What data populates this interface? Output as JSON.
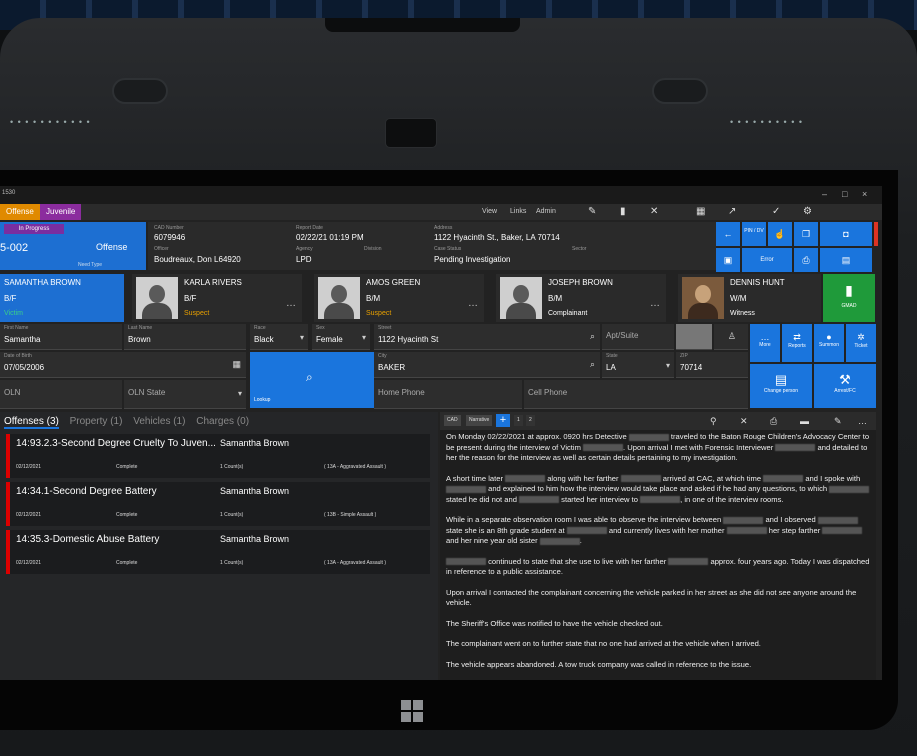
{
  "app": {
    "title": "1530"
  },
  "window_controls": {
    "minimize": "–",
    "maximize": "□",
    "close": "×"
  },
  "tabs": [
    {
      "label": "Offense"
    },
    {
      "label": "Juvenile"
    }
  ],
  "top_menu": {
    "view": "View",
    "links": "Links",
    "admin": "Admin"
  },
  "case": {
    "status": "In Progress",
    "number": "5-002",
    "type": "Offense",
    "sub": "Need Type",
    "cad_number_label": "CAD Number",
    "cad_number": "6079946",
    "report_date_label": "Report Date",
    "report_date": "02/22/21 01:19 PM",
    "address_label": "Address",
    "address": "1122 Hyacinth St., Baker, LA 70714",
    "officer_label": "Officer",
    "officer": "Boudreaux, Don L64920",
    "agency_label": "Agency",
    "agency": "LPD",
    "division_label": "Division",
    "case_status_label": "Case Status",
    "case_status": "Pending Investigation",
    "sector_label": "Sector"
  },
  "actions": {
    "back": "←",
    "pin": "PIN / DV",
    "error": "Error",
    "print": "⎙",
    "save": "💾"
  },
  "persons": [
    {
      "name": "SAMANTHA BROWN",
      "race_sex": "B/F",
      "role": "Victim"
    },
    {
      "name": "KARLA RIVERS",
      "race_sex": "B/F",
      "role": "Suspect"
    },
    {
      "name": "AMOS GREEN",
      "race_sex": "B/M",
      "role": "Suspect"
    },
    {
      "name": "JOSEPH BROWN",
      "race_sex": "B/M",
      "role": "Complainant"
    },
    {
      "name": "DENNIS HUNT",
      "race_sex": "W/M",
      "role": "Witness"
    }
  ],
  "green_button": "GMAD",
  "form": {
    "first_name_label": "First Name",
    "first_name": "Samantha",
    "last_name_label": "Last Name",
    "last_name": "Brown",
    "race_label": "Race",
    "race": "Black",
    "sex_label": "Sex",
    "sex": "Female",
    "street_label": "Street",
    "street": "1122 Hyacinth St",
    "apt_label": "Apt/Suite",
    "dob_label": "Date of Birth",
    "dob": "07/05/2006",
    "city_label": "City",
    "city": "BAKER",
    "state_label": "State",
    "state": "LA",
    "zip_label": "ZIP",
    "zip": "70714",
    "oln_label": "OLN",
    "oln_state_label": "OLN State",
    "home_phone_label": "Home Phone",
    "cell_phone_label": "Cell Phone",
    "lookup_label": "Lookup"
  },
  "right_tiles": {
    "more": "More",
    "reports": "Reports",
    "summon": "Summon",
    "ticket": "Ticket",
    "change_person": "Change person",
    "arrest": "Arrest/FC"
  },
  "offense_tabs": [
    {
      "label": "Offenses (3)"
    },
    {
      "label": "Property (1)"
    },
    {
      "label": "Vehicles (1)"
    },
    {
      "label": "Charges (0)"
    }
  ],
  "offenses": [
    {
      "title": "14:93.2.3-Second Degree Cruelty To Juven...",
      "person": "Samantha Brown",
      "date": "02/12/2021",
      "status": "Complete",
      "counts": "1 Count(s)",
      "code": "( 13A - Aggravated Assault )"
    },
    {
      "title": "14:34.1-Second Degree Battery",
      "person": "Samantha Brown",
      "date": "02/12/2021",
      "status": "Complete",
      "counts": "1 Count(s)",
      "code": "( 13B - Simple Assault )"
    },
    {
      "title": "14:35.3-Domestic Abuse Battery",
      "person": "Samantha Brown",
      "date": "02/12/2021",
      "status": "Complete",
      "counts": "1 Count(s)",
      "code": "( 13A - Aggravated Assault )"
    }
  ],
  "narrative_tools": {
    "cad": "CAD",
    "narrative": "Narrative",
    "plus": "+",
    "page1": "1",
    "page2": "2"
  },
  "narrative": [
    "On Monday 02/22/2021 at approx. 0920 hrs Detective ▒ traveled to the Baton Rouge Children's Advocacy Center to be present during the interview of Victim ▒. Upon arrival I met with Forensic Interviewer ▒ and detailed to her the reason for the interview as well as certain details pertaining to my investigation.",
    "A short time later ▒ along with her farther ▒ arrived at CAC, at which time ▒ and I spoke with ▒ and explained to him how the interview would take place and asked if he had any questions, to which ▒ stated he did not and ▒ started her interview to ▒, in one of the interview rooms.",
    "While in a separate observation room I was able to observe the interview between ▒ and I observed ▒ state she is an 8th grade student at ▒ and currently lives with her mother ▒ her step farther ▒ and her nine year old sister ▒.",
    "▒ continued to state that she use to live with her farther ▒ approx. four years ago. Today I was dispatched in reference to a public assistance.",
    "Upon arrival I contacted the complainant concerning the vehicle parked in her street as she did not see anyone around the vehicle.",
    "The Sheriff's Office was notified to have the vehicle checked out.",
    "The complainant went on to further state that no one had arrived at the vehicle when I arrived.",
    "The vehicle appears abandoned. A tow truck company was called in reference to the issue."
  ]
}
